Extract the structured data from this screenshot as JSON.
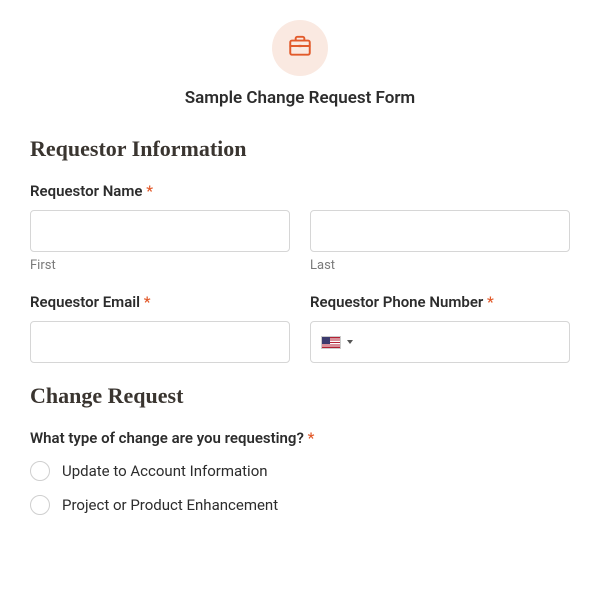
{
  "header": {
    "icon": "briefcase-icon",
    "title": "Sample Change Request Form"
  },
  "sections": {
    "requestor": {
      "heading": "Requestor Information",
      "name_label": "Requestor Name",
      "first_sub": "First",
      "last_sub": "Last",
      "email_label": "Requestor Email",
      "phone_label": "Requestor Phone Number"
    },
    "change": {
      "heading": "Change Request",
      "question": "What type of change are you requesting?",
      "options": [
        "Update to Account Information",
        "Project or Product Enhancement"
      ]
    }
  },
  "required_marker": "*"
}
